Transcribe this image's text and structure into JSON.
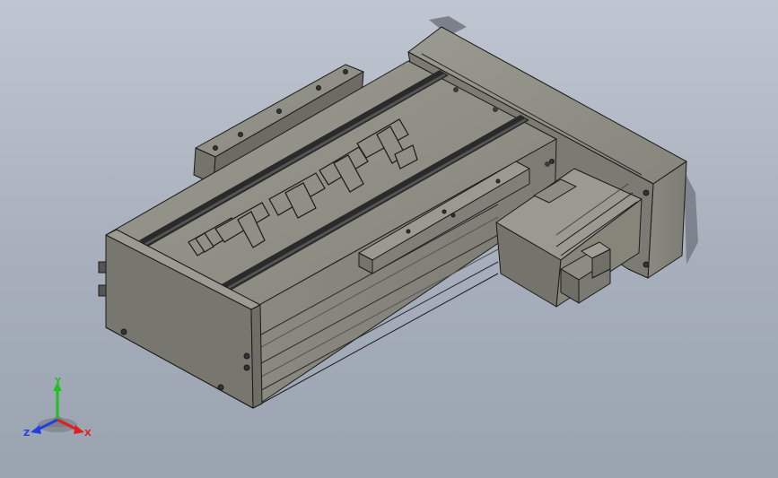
{
  "viewport": {
    "background_top": "#bfc6d1",
    "background_bottom": "#9aa3b0"
  },
  "model": {
    "part_color": "#8d8d84",
    "edge_color": "#1a1a1a",
    "engraved_text": "FUYU"
  },
  "triad": {
    "x_label": "X",
    "y_label": "Y",
    "z_label": "Z",
    "x_color": "#e02020",
    "y_color": "#20c020",
    "z_color": "#2040e0"
  }
}
